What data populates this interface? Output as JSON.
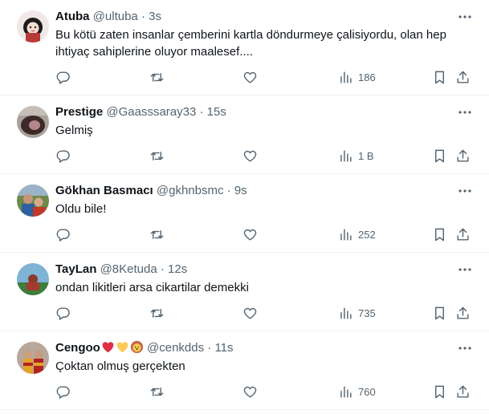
{
  "tweets": [
    {
      "name": "Atuba",
      "handle": "@ultuba",
      "time": "3s",
      "text": "Bu kötü zaten insanlar  çemberini kartla döndurmeye çalisiyordu, olan hep ihtiyaç sahiplerine oluyor maalesef....",
      "views": "186"
    },
    {
      "name": "Prestige",
      "handle": "@Gaasssaray33",
      "time": "15s",
      "text": "Gelmiş",
      "views": "1 B"
    },
    {
      "name": "Gökhan Basmacı",
      "handle": "@gkhnbsmc",
      "time": "9s",
      "text": "Oldu bile!",
      "views": "252"
    },
    {
      "name": "TayLan",
      "handle": "@8Ketuda",
      "time": "12s",
      "text": "ondan likitleri arsa cikartilar demekki",
      "views": "735"
    },
    {
      "name": "Cengoo",
      "name_emojis": [
        "red-heart",
        "yellow-heart",
        "lion-face"
      ],
      "handle": "@cenkdds",
      "time": "11s",
      "text": "Çoktan olmuş gerçekten",
      "views": "760"
    }
  ],
  "separator": "·",
  "icons": {
    "more": "more-dots-icon",
    "reply": "reply-icon",
    "retweet": "retweet-icon",
    "like": "heart-icon",
    "views": "views-chart-icon",
    "bookmark": "bookmark-icon",
    "share": "share-icon"
  },
  "colors": {
    "text": "#0f1419",
    "secondary": "#536471",
    "divider": "#eff3f4"
  }
}
